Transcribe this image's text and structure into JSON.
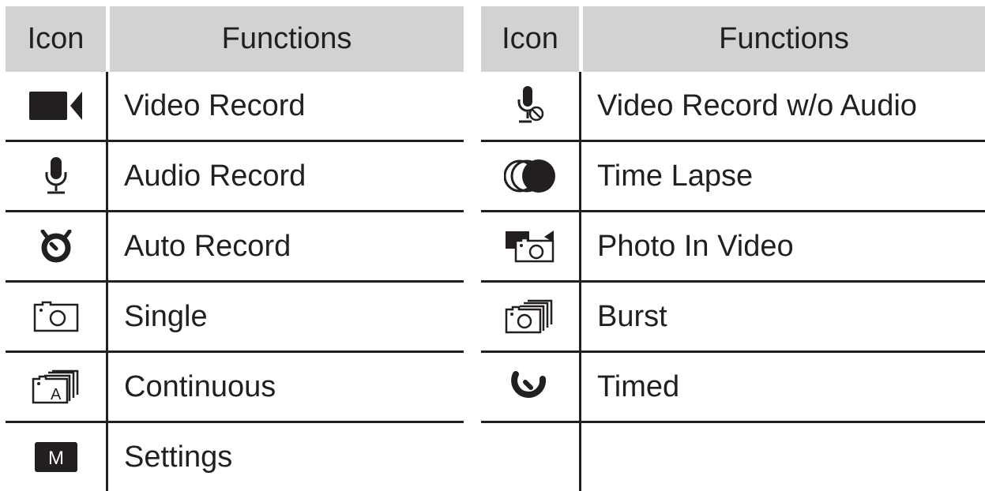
{
  "left_table": {
    "header": {
      "icon": "Icon",
      "functions": "Functions"
    },
    "rows": [
      {
        "icon": "video-camera-icon",
        "function": "Video Record"
      },
      {
        "icon": "microphone-icon",
        "function": "Audio Record"
      },
      {
        "icon": "auto-timer-icon",
        "function": "Auto Record"
      },
      {
        "icon": "camera-icon",
        "function": "Single"
      },
      {
        "icon": "camera-continuous-icon",
        "function": "Continuous"
      },
      {
        "icon": "settings-m-icon",
        "function": "Settings"
      }
    ]
  },
  "right_table": {
    "header": {
      "icon": "Icon",
      "functions": "Functions"
    },
    "rows": [
      {
        "icon": "mic-muted-icon",
        "function": "Video Record w/o Audio"
      },
      {
        "icon": "time-lapse-icon",
        "function": "Time Lapse"
      },
      {
        "icon": "photo-in-video-icon",
        "function": "Photo In Video"
      },
      {
        "icon": "burst-icon",
        "function": "Burst"
      },
      {
        "icon": "timed-icon",
        "function": "Timed"
      },
      {
        "icon": "",
        "function": ""
      }
    ]
  },
  "icon_text": {
    "settings_letter": "M",
    "continuous_letter": "A"
  },
  "colors": {
    "header_bg": "#d1d2d3",
    "ink": "#231f20",
    "background": "#ffffff"
  }
}
